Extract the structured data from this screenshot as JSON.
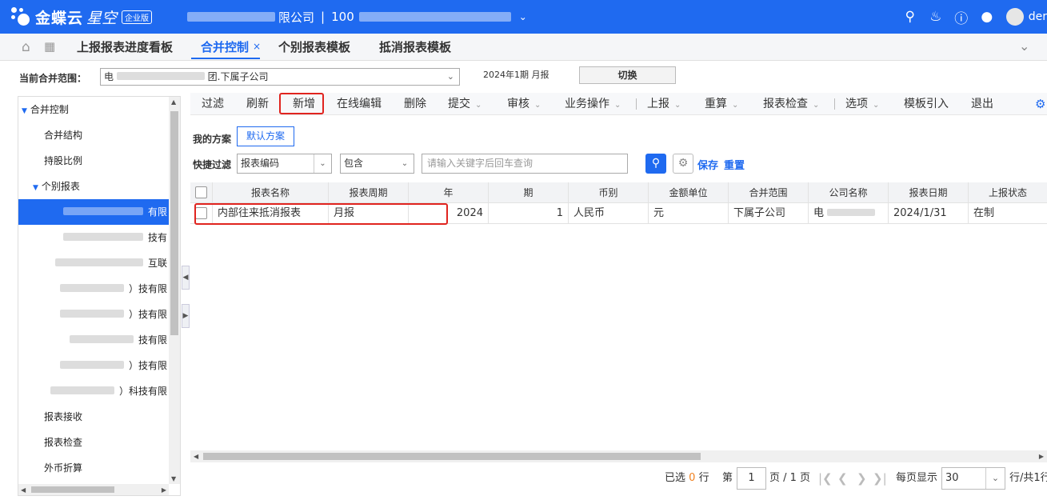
{
  "app": {
    "brand_name": "金蝶云",
    "brand_sub": "星空",
    "brand_badge": "企业版",
    "company_suffix": "限公司",
    "org_code": "100",
    "user": "der"
  },
  "tabs": [
    {
      "label": "上报报表进度看板"
    },
    {
      "label": "合并控制"
    },
    {
      "label": "个别报表模板"
    },
    {
      "label": "抵消报表模板"
    }
  ],
  "scope": {
    "label": "当前合并范围：",
    "value_prefix": "电",
    "value_suffix": "团.下属子公司",
    "period": "2024年1期  月报",
    "switch_label": "切换"
  },
  "tree": {
    "root": "合并控制",
    "items": [
      "合并结构",
      "持股比例"
    ],
    "group": "个别报表",
    "children": [
      "有限",
      "技有",
      "互联",
      "）技有限",
      "）技有限",
      "技有限",
      "）技有限",
      "）科技有限"
    ],
    "bottom_items": [
      "报表接收",
      "报表检查",
      "外币折算"
    ]
  },
  "toolbar": {
    "filter": "过滤",
    "refresh": "刷新",
    "add": "新增",
    "online_edit": "在线编辑",
    "delete": "删除",
    "submit": "提交",
    "audit": "审核",
    "business_ops": "业务操作",
    "report": "上报",
    "recalc": "重算",
    "report_check": "报表检查",
    "options": "选项",
    "template_import": "模板引入",
    "exit": "退出"
  },
  "scheme": {
    "label": "我的方案",
    "default_btn": "默认方案"
  },
  "quick_filter": {
    "label": "快捷过滤",
    "field": "报表编码",
    "operator": "包含",
    "placeholder": "请输入关键字后回车查询",
    "save": "保存",
    "reset": "重置"
  },
  "grid": {
    "columns": [
      "报表名称",
      "报表周期",
      "年",
      "期",
      "币别",
      "金额单位",
      "合并范围",
      "公司名称",
      "报表日期",
      "上报状态"
    ],
    "rows": [
      {
        "name": "内部往来抵消报表",
        "cycle": "月报",
        "year": "2024",
        "period": "1",
        "currency": "人民币",
        "unit": "元",
        "scope": "下属子公司",
        "company": "电",
        "date": "2024/1/31",
        "status": "在制"
      }
    ]
  },
  "pager": {
    "selected_prefix": "已选",
    "selected_count": "0",
    "selected_suffix": "行",
    "page_prefix": "第",
    "page": "1",
    "page_total": "页 / 1 页",
    "per_page_label": "每页显示",
    "per_page": "30",
    "total_suffix": "行/共1行"
  }
}
